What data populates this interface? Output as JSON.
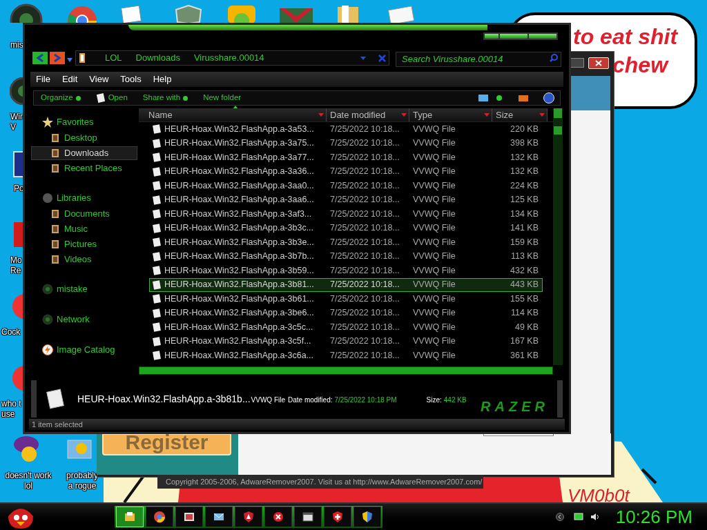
{
  "desktop": {
    "icons": [
      {
        "lines": [
          "mis"
        ]
      },
      {
        "lines": [
          "Win",
          "V"
        ]
      },
      {
        "lines": [
          "Po"
        ]
      },
      {
        "lines": [
          "Mo",
          "Re"
        ]
      },
      {
        "lines": [
          "Cock"
        ]
      },
      {
        "lines": [
          "who t",
          "use"
        ]
      },
      {
        "lines": [
          "doesn't work",
          "lol"
        ]
      },
      {
        "lines": [
          "probably",
          "a rogue"
        ]
      }
    ],
    "bubble_lines": [
      "to eat shit",
      "chew"
    ],
    "signature": "VM0b0t"
  },
  "background_window": {
    "button": "Register",
    "footer": "Copyright 2005-2006, AdwareRemover2007. Visit us at http://www.AdwareRemover2007.com/"
  },
  "explorer": {
    "breadcrumbs": [
      "LOL",
      "Downloads",
      "Virusshare.00014"
    ],
    "search": {
      "placeholder": "Search Virusshare.00014"
    },
    "menu": [
      "File",
      "Edit",
      "View",
      "Tools",
      "Help"
    ],
    "commands": [
      {
        "label": "Organize",
        "kind": "menu"
      },
      {
        "label": "Open",
        "kind": "open"
      },
      {
        "label": "Share with",
        "kind": "menu"
      },
      {
        "label": "New folder",
        "kind": "plain"
      }
    ],
    "nav": [
      {
        "label": "Favorites",
        "kind": "star",
        "children": [
          {
            "label": "Desktop",
            "selected": false
          },
          {
            "label": "Downloads",
            "selected": true
          },
          {
            "label": "Recent Places",
            "selected": false
          }
        ]
      },
      {
        "label": "Libraries",
        "kind": "library",
        "children": [
          {
            "label": "Documents",
            "selected": false
          },
          {
            "label": "Music",
            "selected": false
          },
          {
            "label": "Pictures",
            "selected": false
          },
          {
            "label": "Videos",
            "selected": false
          }
        ]
      },
      {
        "label": "mistake",
        "kind": "orb"
      },
      {
        "label": "Network",
        "kind": "orb"
      },
      {
        "label": "Image Catalog",
        "kind": "bolt"
      }
    ],
    "columns": [
      "Name",
      "Date modified",
      "Type",
      "Size"
    ],
    "rows": [
      {
        "name": "HEUR-Hoax.Win32.FlashApp.a-3a53...",
        "date": "7/25/2022 10:18...",
        "type": "VVWQ File",
        "size": "220 KB",
        "selected": false
      },
      {
        "name": "HEUR-Hoax.Win32.FlashApp.a-3a75...",
        "date": "7/25/2022 10:18...",
        "type": "VVWQ File",
        "size": "398 KB",
        "selected": false
      },
      {
        "name": "HEUR-Hoax.Win32.FlashApp.a-3a77...",
        "date": "7/25/2022 10:18...",
        "type": "VVWQ File",
        "size": "132 KB",
        "selected": false
      },
      {
        "name": "HEUR-Hoax.Win32.FlashApp.a-3a36...",
        "date": "7/25/2022 10:18...",
        "type": "VVWQ File",
        "size": "132 KB",
        "selected": false
      },
      {
        "name": "HEUR-Hoax.Win32.FlashApp.a-3aa0...",
        "date": "7/25/2022 10:18...",
        "type": "VVWQ File",
        "size": "224 KB",
        "selected": false
      },
      {
        "name": "HEUR-Hoax.Win32.FlashApp.a-3aa6...",
        "date": "7/25/2022 10:18...",
        "type": "VVWQ File",
        "size": "125 KB",
        "selected": false
      },
      {
        "name": "HEUR-Hoax.Win32.FlashApp.a-3af3...",
        "date": "7/25/2022 10:18...",
        "type": "VVWQ File",
        "size": "134 KB",
        "selected": false
      },
      {
        "name": "HEUR-Hoax.Win32.FlashApp.a-3b3c...",
        "date": "7/25/2022 10:18...",
        "type": "VVWQ File",
        "size": "141 KB",
        "selected": false
      },
      {
        "name": "HEUR-Hoax.Win32.FlashApp.a-3b3e...",
        "date": "7/25/2022 10:18...",
        "type": "VVWQ File",
        "size": "159 KB",
        "selected": false
      },
      {
        "name": "HEUR-Hoax.Win32.FlashApp.a-3b7b...",
        "date": "7/25/2022 10:18...",
        "type": "VVWQ File",
        "size": "113 KB",
        "selected": false
      },
      {
        "name": "HEUR-Hoax.Win32.FlashApp.a-3b59...",
        "date": "7/25/2022 10:18...",
        "type": "VVWQ File",
        "size": "432 KB",
        "selected": false
      },
      {
        "name": "HEUR-Hoax.Win32.FlashApp.a-3b81...",
        "date": "7/25/2022 10:18...",
        "type": "VVWQ File",
        "size": "443 KB",
        "selected": true
      },
      {
        "name": "HEUR-Hoax.Win32.FlashApp.a-3b61...",
        "date": "7/25/2022 10:18...",
        "type": "VVWQ File",
        "size": "155 KB",
        "selected": false
      },
      {
        "name": "HEUR-Hoax.Win32.FlashApp.a-3be6...",
        "date": "7/25/2022 10:18...",
        "type": "VVWQ File",
        "size": "114 KB",
        "selected": false
      },
      {
        "name": "HEUR-Hoax.Win32.FlashApp.a-3c5c...",
        "date": "7/25/2022 10:18...",
        "type": "VVWQ File",
        "size": "49 KB",
        "selected": false
      },
      {
        "name": "HEUR-Hoax.Win32.FlashApp.a-3c5f...",
        "date": "7/25/2022 10:18...",
        "type": "VVWQ File",
        "size": "167 KB",
        "selected": false
      },
      {
        "name": "HEUR-Hoax.Win32.FlashApp.a-3c6a...",
        "date": "7/25/2022 10:18...",
        "type": "VVWQ File",
        "size": "361 KB",
        "selected": false
      }
    ],
    "details": {
      "name": "HEUR-Hoax.Win32.FlashApp.a-3b81b...",
      "type": "VVWQ File",
      "date_label": "Date modified:",
      "date": "7/25/2022 10:18 PM",
      "size_label": "Size:",
      "size": "442 KB",
      "logo": "RAZER"
    },
    "status": "1 item selected"
  },
  "taskbar": {
    "buttons": [
      {
        "selected": true
      },
      {
        "selected": false
      },
      {
        "selected": false
      },
      {
        "selected": false
      },
      {
        "selected": false
      },
      {
        "selected": false
      },
      {
        "selected": false
      },
      {
        "selected": false
      },
      {
        "selected": false
      }
    ],
    "clock": "10:26 PM"
  }
}
